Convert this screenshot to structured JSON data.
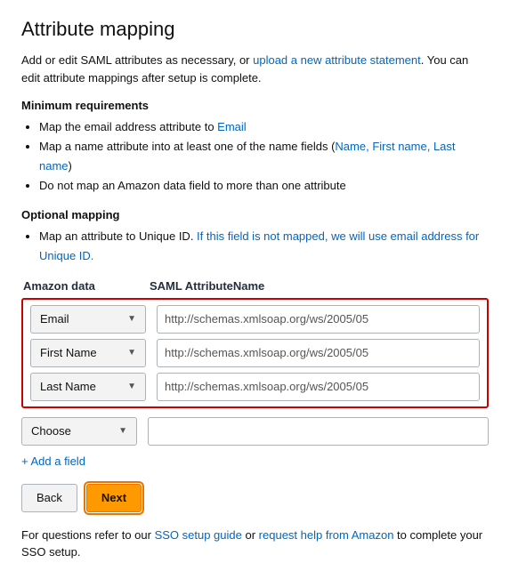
{
  "page": {
    "title": "Attribute mapping",
    "intro": {
      "text_before_link": "Add or edit SAML attributes as necessary, or ",
      "link1_text": "upload a new attribute statement",
      "text_after_link1": ". You can edit attribute mappings after setup is complete."
    },
    "minimum_requirements": {
      "heading": "Minimum requirements",
      "items": [
        {
          "text_before": "Map the email address attribute to ",
          "link_text": "Email",
          "text_after": ""
        },
        {
          "text_before": "Map a name attribute into at least one of the name fields (",
          "link_text": "Name, First name, Last name",
          "text_after": ")"
        },
        {
          "text_before": "Do not map an Amazon data field to more than one attribute",
          "link_text": "",
          "text_after": ""
        }
      ]
    },
    "optional_mapping": {
      "heading": "Optional mapping",
      "items": [
        {
          "text_before": "Map an attribute to Unique ID. ",
          "link_text": "If this field is not mapped, we will use email address for Unique ID.",
          "text_after": ""
        }
      ]
    },
    "table_headers": {
      "amazon_data": "Amazon data",
      "saml_attribute": "SAML AttributeName"
    },
    "required_rows": [
      {
        "dropdown_label": "Email",
        "input_value": "http://schemas.xmlsoap.org/ws/2005/05"
      },
      {
        "dropdown_label": "First Name",
        "input_value": "http://schemas.xmlsoap.org/ws/2005/05"
      },
      {
        "dropdown_label": "Last Name",
        "input_value": "http://schemas.xmlsoap.org/ws/2005/05"
      }
    ],
    "optional_row": {
      "dropdown_label": "Choose",
      "input_value": ""
    },
    "add_field_label": "+ Add a field",
    "buttons": {
      "back": "Back",
      "next": "Next"
    },
    "footer": {
      "text_before": "For questions refer to our ",
      "link1_text": "SSO setup guide",
      "text_middle": " or ",
      "link2_text": "request help from Amazon",
      "text_after": " to complete your SSO setup."
    }
  }
}
